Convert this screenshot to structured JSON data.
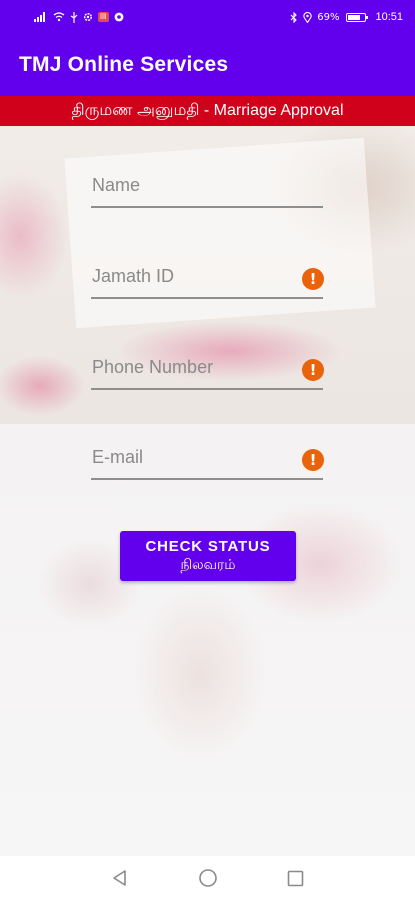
{
  "status_bar": {
    "left_icons": [
      "signal-icon",
      "wifi-icon",
      "usb-icon",
      "settings-icon",
      "notification-badge-icon",
      "chrome-icon"
    ],
    "right_icons": [
      "bluetooth-icon",
      "location-icon"
    ],
    "battery_text": "69%",
    "battery_level": 0.69,
    "time": "10:51"
  },
  "app_bar": {
    "title": "TMJ Online Services"
  },
  "banner": {
    "text": "திருமண அனுமதி  - Marriage Approval"
  },
  "form": {
    "name": {
      "placeholder": "Name",
      "value": ""
    },
    "jamath_id": {
      "placeholder": "Jamath ID",
      "value": ""
    },
    "phone": {
      "placeholder": "Phone Number",
      "value": ""
    },
    "email": {
      "placeholder": "E-mail",
      "value": ""
    },
    "error_icon": "!"
  },
  "check_button": {
    "label_en": "CHECK STATUS",
    "label_ta": "நிலவரம்"
  },
  "nav": {
    "back": "back-icon",
    "home": "home-icon",
    "recents": "recents-icon"
  },
  "colors": {
    "primary": "#6200ee",
    "banner": "#d0021b",
    "error": "#e8630a"
  }
}
